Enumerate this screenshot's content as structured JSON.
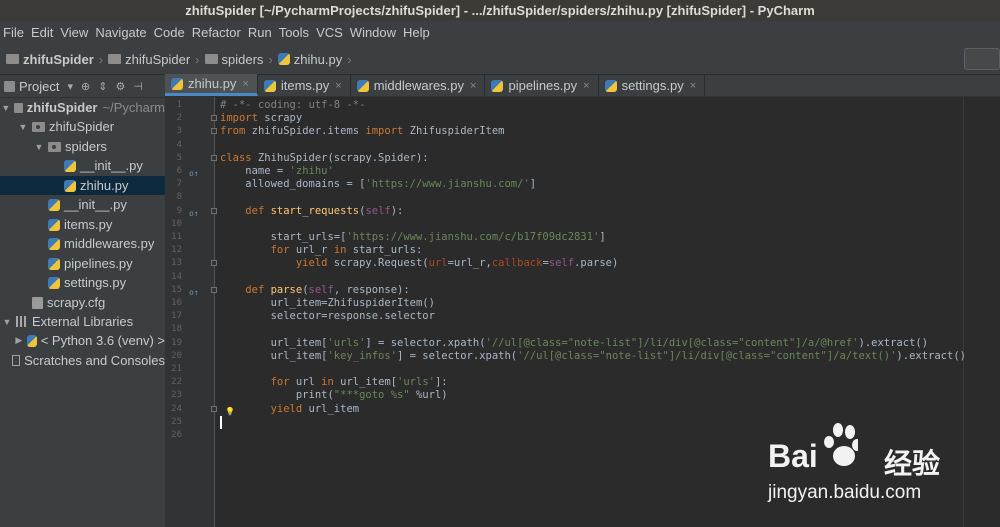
{
  "window": {
    "title": "zhifuSpider [~/PycharmProjects/zhifuSpider] - .../zhifuSpider/spiders/zhihu.py [zhifuSpider] - PyCharm"
  },
  "menu": [
    "File",
    "Edit",
    "View",
    "Navigate",
    "Code",
    "Refactor",
    "Run",
    "Tools",
    "VCS",
    "Window",
    "Help"
  ],
  "breadcrumb": [
    "zhifuSpider",
    "zhifuSpider",
    "spiders",
    "zhihu.py"
  ],
  "project_panel": {
    "title": "Project",
    "tree": [
      {
        "label": "zhifuSpider",
        "hint": "~/Pycharm",
        "type": "root",
        "expanded": true
      },
      {
        "label": "zhifuSpider",
        "type": "package",
        "expanded": true
      },
      {
        "label": "spiders",
        "type": "package",
        "expanded": true
      },
      {
        "label": "__init__.py",
        "type": "py"
      },
      {
        "label": "zhihu.py",
        "type": "py",
        "selected": true
      },
      {
        "label": "__init__.py",
        "type": "py"
      },
      {
        "label": "items.py",
        "type": "py"
      },
      {
        "label": "middlewares.py",
        "type": "py"
      },
      {
        "label": "pipelines.py",
        "type": "py"
      },
      {
        "label": "settings.py",
        "type": "py"
      },
      {
        "label": "scrapy.cfg",
        "type": "cfg"
      },
      {
        "label": "External Libraries",
        "type": "lib",
        "expanded": true
      },
      {
        "label": "< Python 3.6 (venv) >",
        "type": "python",
        "expanded": false
      },
      {
        "label": "Scratches and Consoles",
        "type": "scratch"
      }
    ]
  },
  "tabs": [
    {
      "label": "zhihu.py",
      "active": true
    },
    {
      "label": "items.py"
    },
    {
      "label": "middlewares.py"
    },
    {
      "label": "pipelines.py"
    },
    {
      "label": "settings.py"
    }
  ],
  "editor": {
    "lines": [
      "# -*- coding: utf-8 -*-",
      "import scrapy",
      "from zhifuSpider.items import ZhifuspiderItem",
      "",
      "class ZhihuSpider(scrapy.Spider):",
      "    name = 'zhihu'",
      "    allowed_domains = ['https://www.jianshu.com/']",
      "",
      "    def start_requests(self):",
      "",
      "        start_urls=['https://www.jianshu.com/c/b17f09dc2831']",
      "        for url_r in start_urls:",
      "            yield scrapy.Request(url=url_r,callback=self.parse)",
      "",
      "    def parse(self, response):",
      "        url_item=ZhifuspiderItem()",
      "        selector=response.selector",
      "",
      "        url_item['urls'] = selector.xpath('//ul[@class=\"note-list\"]/li/div[@class=\"content\"]/a/@href').extract()",
      "        url_item['key_infos'] = selector.xpath('//ul[@class=\"note-list\"]/li/div[@class=\"content\"]/a/text()').extract()",
      "",
      "        for url in url_item['urls']:",
      "            print(\"***goto %s\" %url)",
      "        yield url_item",
      "",
      ""
    ]
  },
  "watermark": {
    "brand": "Bai",
    "cn": "经验",
    "url": "jingyan.baidu.com"
  }
}
